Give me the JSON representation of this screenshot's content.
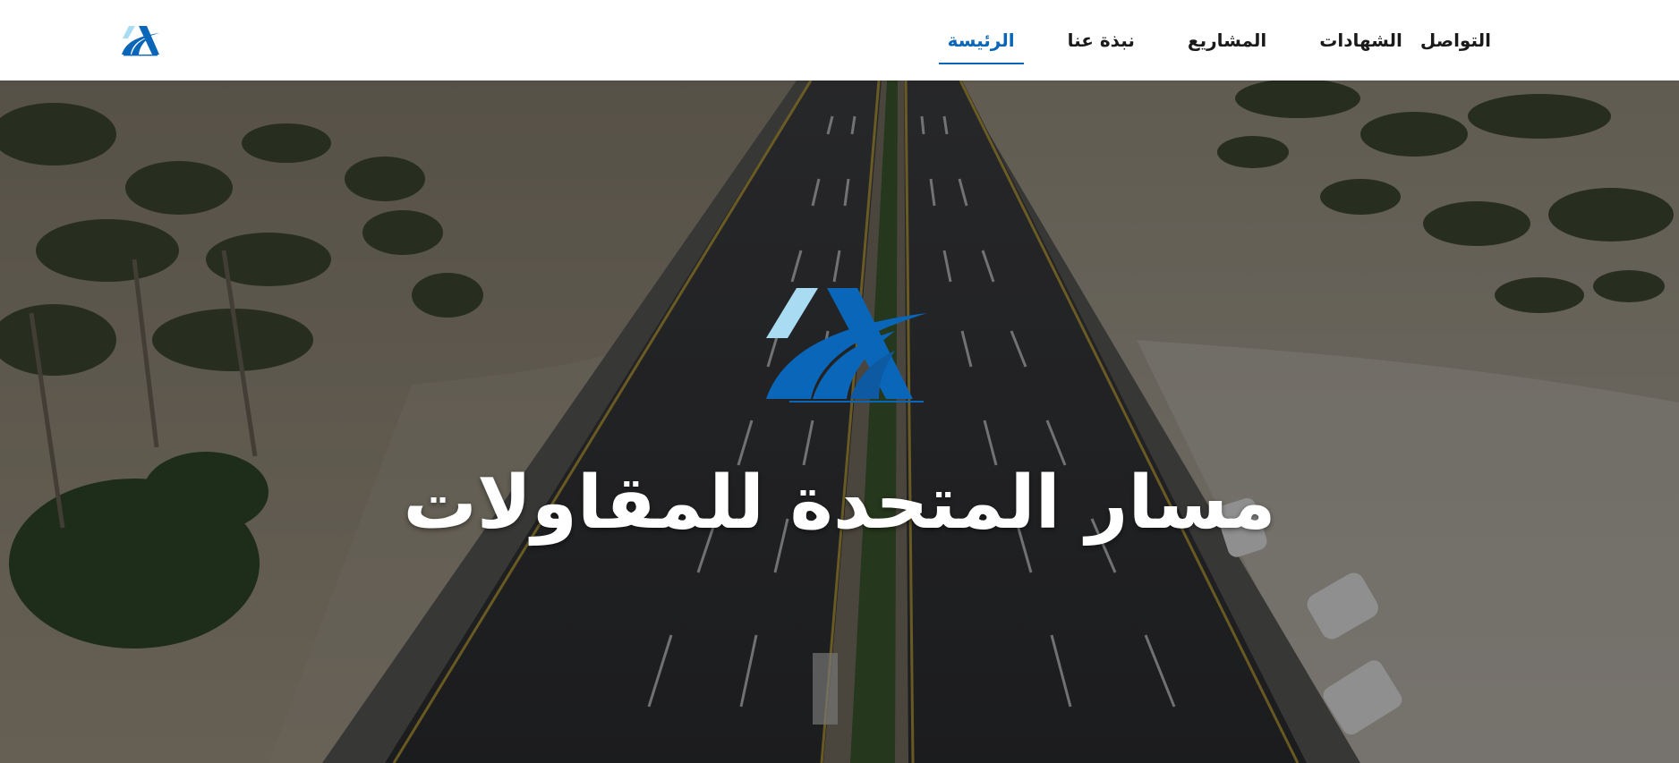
{
  "header": {
    "logo_icon": "company-logo-icon",
    "nav": [
      {
        "label": "الرئيسة",
        "active": true
      },
      {
        "label": "نبذة عنا",
        "active": false
      },
      {
        "label": "المشاريع",
        "active": false
      },
      {
        "label": "الشهادات",
        "active": false
      },
      {
        "label": "التواصل",
        "active": false
      }
    ]
  },
  "hero": {
    "background": "aerial-highway-photo",
    "logo_icon": "masar-logo-icon",
    "title": "مسار المتحدة للمقاولات"
  },
  "colors": {
    "brand_blue": "#0a66b8",
    "brand_light_blue": "#a9dcf2",
    "nav_text": "#1a1a1a",
    "header_bg": "#ffffff",
    "hero_text": "#ffffff"
  }
}
